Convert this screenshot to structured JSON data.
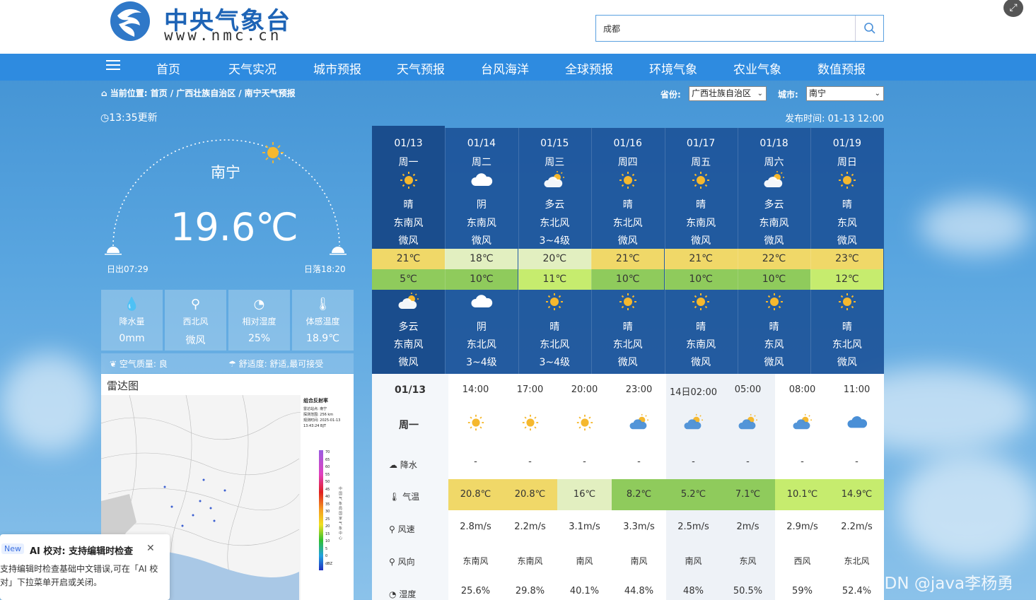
{
  "header": {
    "logo_cn": "中央气象台",
    "logo_url": "www.nmc.cn",
    "search_value": "成都"
  },
  "nav": {
    "items": [
      "首页",
      "天气实况",
      "城市预报",
      "天气预报",
      "台风海洋",
      "全球预报",
      "环境气象",
      "农业气象",
      "数值预报"
    ]
  },
  "breadcrumb": {
    "prefix": "当前位置:",
    "items": [
      "首页",
      "广西壮族自治区",
      "南宁天气预报"
    ]
  },
  "selectors": {
    "province_label": "省份:",
    "province_value": "广西壮族自治区",
    "city_label": "城市:",
    "city_value": "南宁"
  },
  "update_time": "13:35更新",
  "publish_time": "发布时间:  01-13 12:00",
  "current": {
    "city": "南宁",
    "temperature": "19.6℃",
    "sunrise": "日出07:29",
    "sunset": "日落18:20",
    "conditions": [
      {
        "icon": "raindrops-icon",
        "label": "降水量",
        "value": "0mm"
      },
      {
        "icon": "wind-vane-icon",
        "label": "西北风",
        "value": "微风"
      },
      {
        "icon": "humidity-drop-icon",
        "label": "相对湿度",
        "value": "25%"
      },
      {
        "icon": "thermometer-icon",
        "label": "体感温度",
        "value": "18.9℃"
      }
    ],
    "air_quality": "空气质量: 良",
    "comfort": "舒适度: 舒适,最可接受"
  },
  "radar": {
    "title": "雷达图",
    "legend_title": "组合反射率",
    "legend_lines": [
      "雷达站点: 南宁",
      "探测范围: 256 km",
      "观测时间: 2025-01-13",
      "13:43:24 BJT"
    ],
    "legend_scale": [
      "70",
      "65",
      "60",
      "55",
      "50",
      "45",
      "40",
      "35",
      "30",
      "25",
      "20",
      "15",
      "10",
      "5",
      "0",
      "dBZ"
    ],
    "side_caption": "中国气象局国家气象中心"
  },
  "forecast": [
    {
      "date": "01/13",
      "weekday": "周一",
      "day_icon": "sun-icon",
      "day_weather": "晴",
      "day_wind_dir": "东南风",
      "day_wind_level": "微风",
      "high": "21℃",
      "low": "5℃",
      "night_icon": "partly-cloudy-icon",
      "night_weather": "多云",
      "night_wind_dir": "东南风",
      "night_wind_level": "微风"
    },
    {
      "date": "01/14",
      "weekday": "周二",
      "day_icon": "cloud-icon",
      "day_weather": "阴",
      "day_wind_dir": "东南风",
      "day_wind_level": "微风",
      "high": "18℃",
      "low": "10℃",
      "night_icon": "cloud-icon",
      "night_weather": "阴",
      "night_wind_dir": "东北风",
      "night_wind_level": "3~4级"
    },
    {
      "date": "01/15",
      "weekday": "周三",
      "day_icon": "partly-cloudy-icon",
      "day_weather": "多云",
      "day_wind_dir": "东北风",
      "day_wind_level": "3~4级",
      "high": "20℃",
      "low": "11℃",
      "night_icon": "sun-icon",
      "night_weather": "晴",
      "night_wind_dir": "东北风",
      "night_wind_level": "3~4级"
    },
    {
      "date": "01/16",
      "weekday": "周四",
      "day_icon": "sun-icon",
      "day_weather": "晴",
      "day_wind_dir": "东北风",
      "day_wind_level": "微风",
      "high": "21℃",
      "low": "10℃",
      "night_icon": "sun-icon",
      "night_weather": "晴",
      "night_wind_dir": "东北风",
      "night_wind_level": "微风"
    },
    {
      "date": "01/17",
      "weekday": "周五",
      "day_icon": "sun-icon",
      "day_weather": "晴",
      "day_wind_dir": "东南风",
      "day_wind_level": "微风",
      "high": "21℃",
      "low": "10℃",
      "night_icon": "sun-icon",
      "night_weather": "晴",
      "night_wind_dir": "东南风",
      "night_wind_level": "微风"
    },
    {
      "date": "01/18",
      "weekday": "周六",
      "day_icon": "partly-cloudy-icon",
      "day_weather": "多云",
      "day_wind_dir": "东南风",
      "day_wind_level": "微风",
      "high": "22℃",
      "low": "10℃",
      "night_icon": "sun-icon",
      "night_weather": "晴",
      "night_wind_dir": "东风",
      "night_wind_level": "微风"
    },
    {
      "date": "01/19",
      "weekday": "周日",
      "day_icon": "sun-icon",
      "day_weather": "晴",
      "day_wind_dir": "东风",
      "day_wind_level": "微风",
      "high": "23℃",
      "low": "12℃",
      "night_icon": "sun-icon",
      "night_weather": "晴",
      "night_wind_dir": "东北风",
      "night_wind_level": "微风"
    }
  ],
  "forecast_colors": {
    "high": [
      "#f0d868",
      "#e2efc0",
      "#e2efc0",
      "#f0d868",
      "#f0d868",
      "#f0d868",
      "#f0d868"
    ],
    "low": [
      "#8fcb5c",
      "#8fcb5c",
      "#c6ec6e",
      "#8fcb5c",
      "#8fcb5c",
      "#8fcb5c",
      "#c6ec6e"
    ]
  },
  "hourly": {
    "date": "01/13",
    "weekday": "周一",
    "row_labels": [
      "降水",
      "气温",
      "风速",
      "风向",
      "湿度"
    ],
    "hours": [
      {
        "time": "14:00",
        "icon": "sun-icon",
        "rain": "-",
        "temp": "20.8℃",
        "temp_color": "#f0d868",
        "wind_speed": "2.8m/s",
        "wind_dir": "东南风",
        "humidity": "25.6%",
        "night": false
      },
      {
        "time": "17:00",
        "icon": "sun-icon",
        "rain": "-",
        "temp": "20.8℃",
        "temp_color": "#f0d868",
        "wind_speed": "2.2m/s",
        "wind_dir": "东南风",
        "humidity": "29.8%",
        "night": false
      },
      {
        "time": "20:00",
        "icon": "sun-icon",
        "rain": "-",
        "temp": "16℃",
        "temp_color": "#e2efc0",
        "wind_speed": "3.1m/s",
        "wind_dir": "南风",
        "humidity": "40.1%",
        "night": false
      },
      {
        "time": "23:00",
        "icon": "partly-cloudy-icon",
        "rain": "-",
        "temp": "8.2℃",
        "temp_color": "#8fcb5c",
        "wind_speed": "3.3m/s",
        "wind_dir": "南风",
        "humidity": "44.8%",
        "night": false
      },
      {
        "time": "14日02:00",
        "icon": "partly-cloudy-icon",
        "rain": "-",
        "temp": "5.2℃",
        "temp_color": "#8fcb5c",
        "wind_speed": "2.5m/s",
        "wind_dir": "南风",
        "humidity": "48%",
        "night": true
      },
      {
        "time": "05:00",
        "icon": "partly-cloudy-icon",
        "rain": "-",
        "temp": "7.1℃",
        "temp_color": "#8fcb5c",
        "wind_speed": "2m/s",
        "wind_dir": "东风",
        "humidity": "50.5%",
        "night": true
      },
      {
        "time": "08:00",
        "icon": "partly-cloudy-icon",
        "rain": "-",
        "temp": "10.1℃",
        "temp_color": "#c6ec6e",
        "wind_speed": "2.9m/s",
        "wind_dir": "西风",
        "humidity": "59%",
        "night": false
      },
      {
        "time": "11:00",
        "icon": "cloud-icon",
        "rain": "-",
        "temp": "14.9℃",
        "temp_color": "#c6ec6e",
        "wind_speed": "2.2m/s",
        "wind_dir": "东北风",
        "humidity": "52.4%",
        "night": false
      }
    ]
  },
  "popup": {
    "badge": "New",
    "title": "AI 校对: 支持编辑时检查",
    "body": "支持编辑时检查基础中文错误,可在「AI 校对」下拉菜单开启或关闭。"
  },
  "watermark": "CSDN @java李杨勇",
  "colors": {
    "accent_blue": "#2e8be0",
    "forecast_bg": "#1c5298",
    "sun": "#f5b82e"
  }
}
